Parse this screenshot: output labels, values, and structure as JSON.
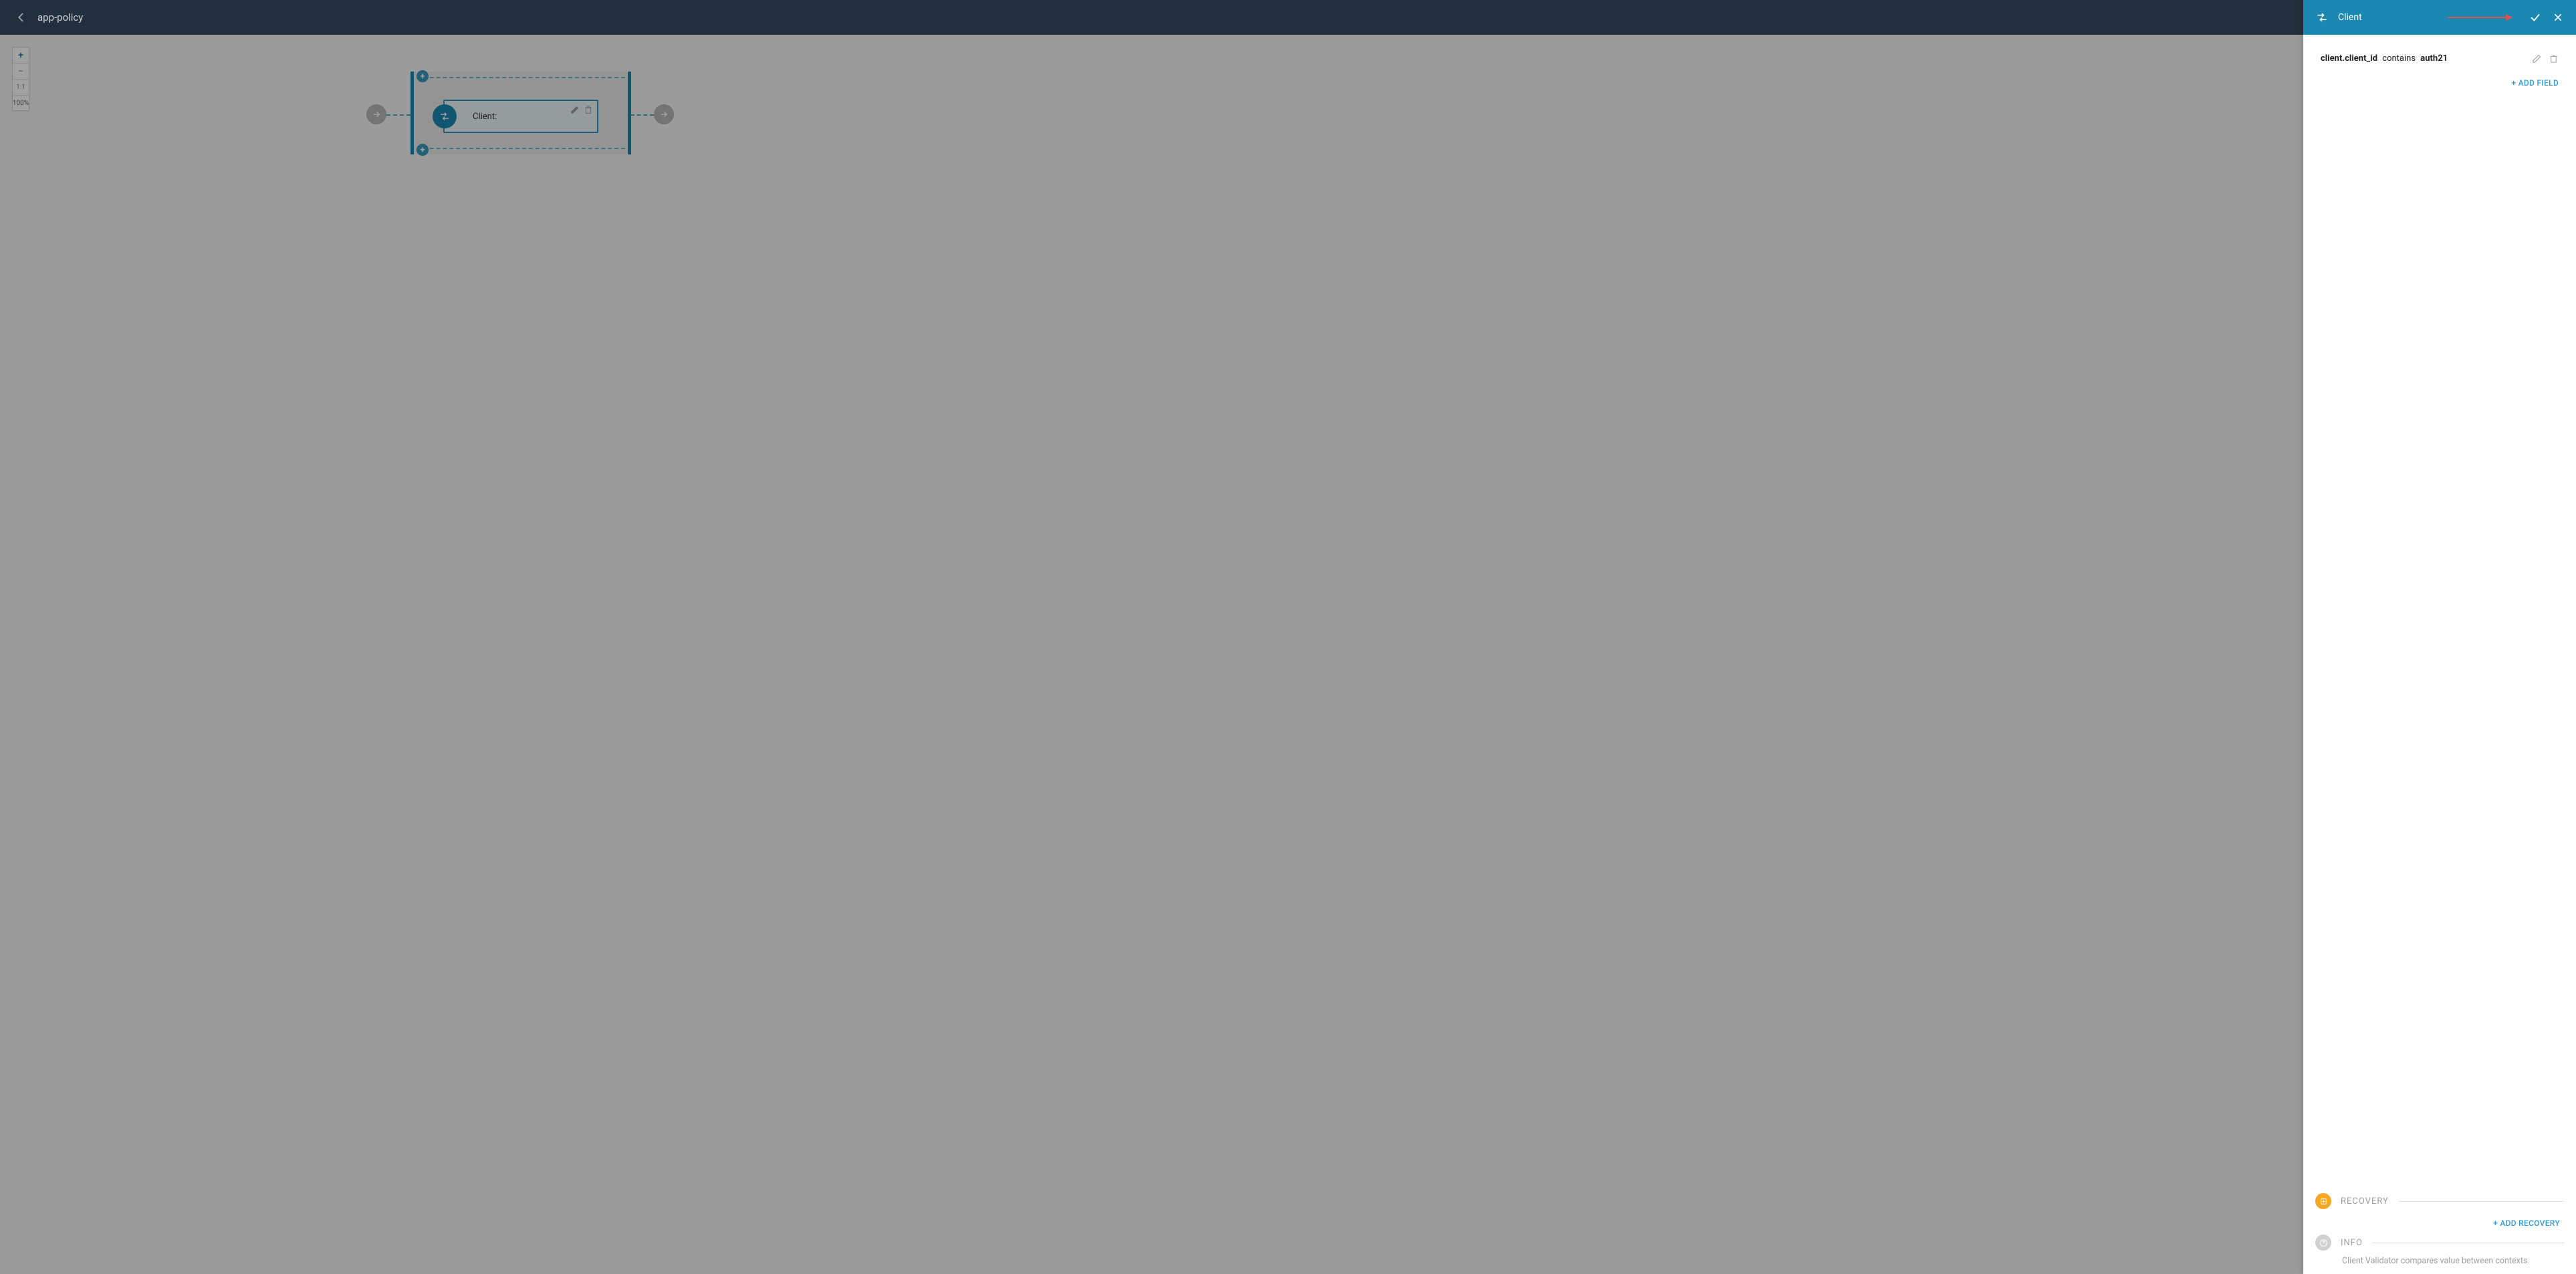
{
  "header": {
    "title": "app-policy"
  },
  "zoom": {
    "plus": "+",
    "minus": "−",
    "fit": "1:1",
    "percent": "100%"
  },
  "flow": {
    "client_label": "Client:"
  },
  "panel": {
    "title": "Client",
    "condition": {
      "field": "client.client_id",
      "op": "contains",
      "value": "auth21"
    },
    "add_field": "+ ADD FIELD",
    "recovery_label": "RECOVERY",
    "add_recovery": "+ ADD RECOVERY",
    "info_label": "INFO",
    "info_text": "Client Validator compares value between contexts."
  }
}
